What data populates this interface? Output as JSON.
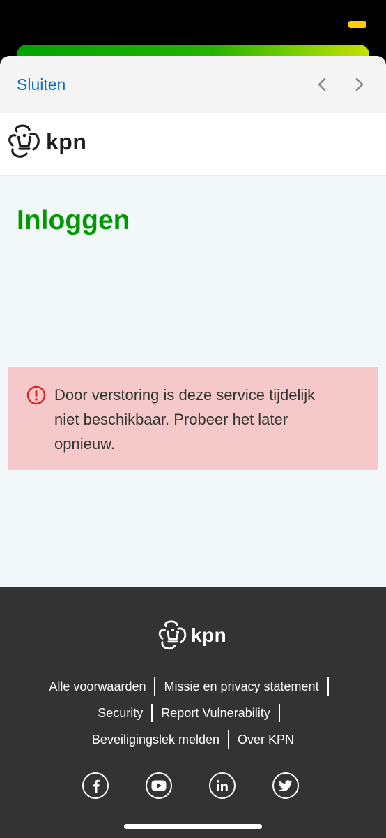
{
  "toolbar": {
    "close_label": "Sluiten"
  },
  "header": {
    "brand": "kpn"
  },
  "main": {
    "title": "Inloggen",
    "alert_message": "Door verstoring is deze service tijdelijk niet beschikbaar. Probeer het later opnieuw."
  },
  "footer": {
    "brand": "kpn",
    "links": [
      "Alle voorwaarden",
      "Missie en privacy statement",
      "Security",
      "Report Vulnerability",
      "Beveiligingslek melden",
      "Over KPN"
    ],
    "social": [
      "facebook-icon",
      "youtube-icon",
      "linkedin-icon",
      "twitter-icon"
    ]
  },
  "colors": {
    "brand_green": "#009900",
    "link_blue": "#0a6ebd",
    "alert_bg": "#f5c9c9",
    "alert_icon": "#e02020",
    "footer_bg": "#333333"
  }
}
